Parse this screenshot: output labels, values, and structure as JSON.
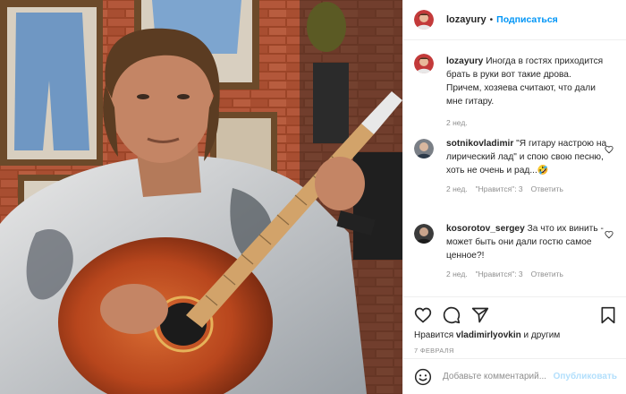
{
  "post": {
    "author": "lozayury",
    "follow_label": "Подписаться",
    "dot": "•"
  },
  "caption": {
    "user": "lozayury",
    "text": "Иногда в гостях приходится брать в руки вот такие дрова. Причем, хозяева считают, что дали мне гитару.",
    "time": "2 нед."
  },
  "comments": [
    {
      "user": "sotnikovladimir",
      "text": "\"Я гитару настрою на лирический лад\" и спою свою песню, хоть не очень и рад...",
      "emoji": "🤣",
      "time": "2 нед.",
      "likes": "\"Нравится\": 3",
      "reply": "Ответить"
    },
    {
      "user": "kosorotov_sergey",
      "text": "За что их винить - может быть они дали гостю самое ценное?!",
      "time": "2 нед.",
      "likes": "\"Нравится\": 3",
      "reply": "Ответить"
    }
  ],
  "likes_line": {
    "prefix": "Нравится",
    "user": "vladimirlyovkin",
    "suffix": "и другим"
  },
  "date": "7 ФЕВРАЛЯ",
  "add_comment": {
    "placeholder": "Добавьте комментарий...",
    "publish": "Опубликовать"
  },
  "icons": [
    "heart-icon",
    "comment-icon",
    "share-icon",
    "bookmark-icon",
    "emoji-icon"
  ],
  "colors": {
    "accent": "#0095f6",
    "publish_disabled": "#b2dffc",
    "muted": "#8e8e8e"
  }
}
